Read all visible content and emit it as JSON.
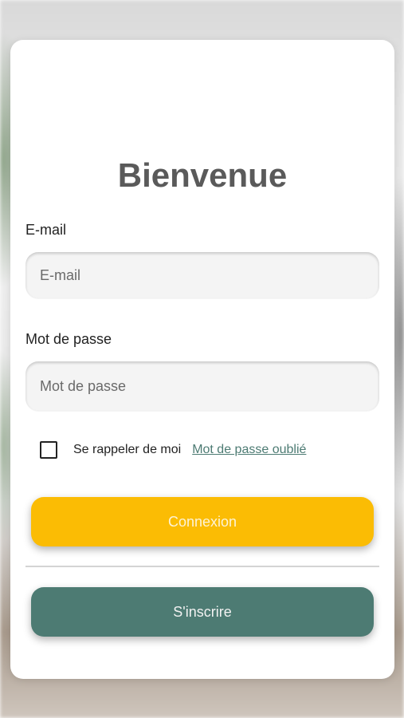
{
  "form": {
    "title": "Bienvenue",
    "email_label": "E-mail",
    "email_placeholder": "E-mail",
    "email_value": "",
    "password_label": "Mot de passe",
    "password_placeholder": "Mot de passe",
    "password_value": "",
    "remember_label": "Se rappeler de moi",
    "remember_checked": false,
    "forgot_link": "Mot de passe oublié",
    "login_button": "Connexion",
    "signup_button": "S'inscrire"
  },
  "colors": {
    "primary_yellow": "#fbbc04",
    "primary_teal": "#4d7b73",
    "title_gray": "#5a5a5a",
    "field_bg": "#f4f4f4"
  }
}
